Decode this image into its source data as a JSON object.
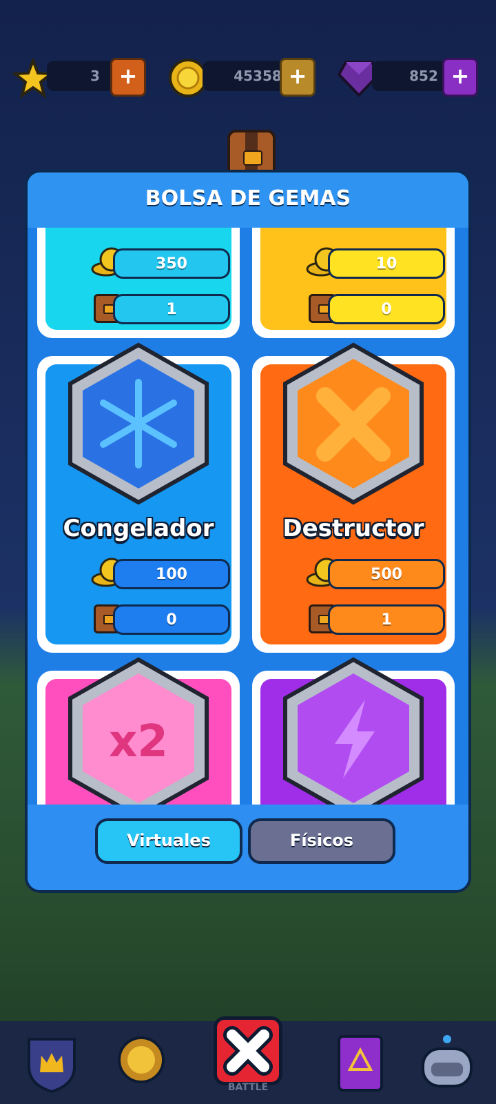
{
  "top_bar": {
    "stars": "3",
    "coins": "45358",
    "gems": "852",
    "plus_label": "+"
  },
  "modal": {
    "title": "BOLSA DE GEMAS"
  },
  "cards": [
    {
      "name": "",
      "coins": "350",
      "chests": "1"
    },
    {
      "name": "",
      "coins": "10",
      "chests": "0"
    },
    {
      "name": "Congelador",
      "coins": "100",
      "chests": "0"
    },
    {
      "name": "Destructor",
      "coins": "500",
      "chests": "1"
    },
    {
      "name": "",
      "coins": "",
      "chests": ""
    },
    {
      "name": "",
      "coins": "",
      "chests": ""
    }
  ],
  "gems_art": {
    "congelador": "snowflake-icon",
    "destructor": "cracked-x-icon",
    "x2": "x2",
    "speed": "lightning-icon"
  },
  "tabs": {
    "virtual": "Virtuales",
    "physical": "Físicos"
  },
  "bottom_nav": {
    "battle": "BATTLE"
  },
  "colors": {
    "cyan": "#19d6ef",
    "yellow": "#ffc21a",
    "blue": "#1597f2",
    "orange": "#ff6a12",
    "pink": "#ff4fbf",
    "purple": "#a02ee8"
  }
}
